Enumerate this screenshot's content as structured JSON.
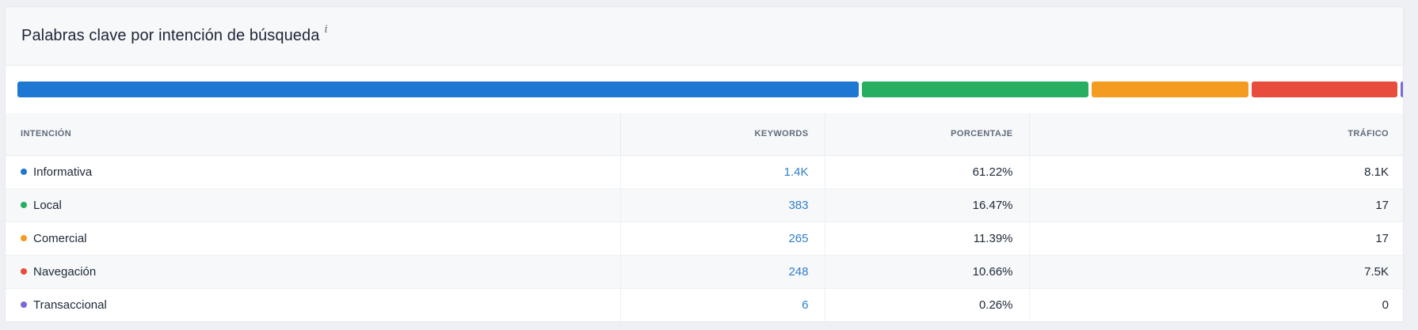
{
  "header": {
    "title": "Palabras clave por intención de búsqueda",
    "info_glyph": "i"
  },
  "table": {
    "columns": {
      "intent": "INTENCIÓN",
      "keywords": "KEYWORDS",
      "percentage": "PORCENTAJE",
      "traffic": "TRÁFICO"
    },
    "rows": [
      {
        "intent": "Informativa",
        "keywords": "1.4K",
        "percentage": "61.22%",
        "traffic": "8.1K",
        "color": "#1f77d4",
        "share": 61.22
      },
      {
        "intent": "Local",
        "keywords": "383",
        "percentage": "16.47%",
        "traffic": "17",
        "color": "#27ae60",
        "share": 16.47
      },
      {
        "intent": "Comercial",
        "keywords": "265",
        "percentage": "11.39%",
        "traffic": "17",
        "color": "#f39c1f",
        "share": 11.39
      },
      {
        "intent": "Navegación",
        "keywords": "248",
        "percentage": "10.66%",
        "traffic": "7.5K",
        "color": "#e74c3c",
        "share": 10.66
      },
      {
        "intent": "Transaccional",
        "keywords": "6",
        "percentage": "0.26%",
        "traffic": "0",
        "color": "#7b68d9",
        "share": 0.26
      }
    ]
  }
}
